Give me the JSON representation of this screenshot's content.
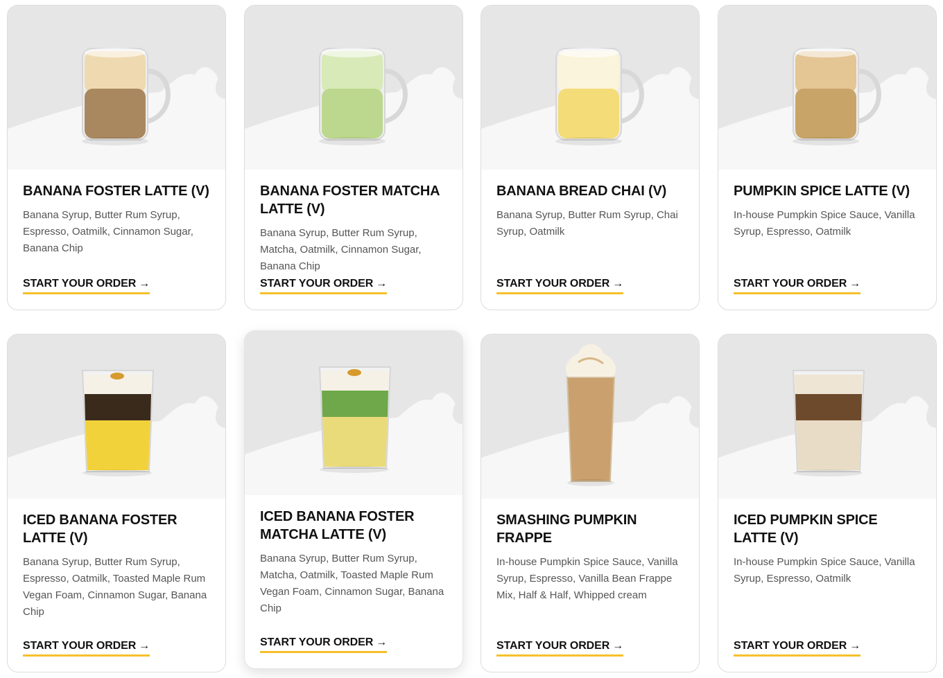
{
  "menu": {
    "cta_label": "START YOUR ORDER",
    "cta_arrow": "→",
    "accent_color": "#f6c02a",
    "items": [
      {
        "title": "BANANA FOSTER LATTE (V)",
        "description": "Banana Syrup, Butter Rum Syrup, Espresso, Oatmilk, Cinnamon Sugar, Banana Chip",
        "image": "hot-latte-mug-icon",
        "drink_color": "#a98860",
        "foam_color": "#efd9b0"
      },
      {
        "title": "BANANA FOSTER MATCHA LATTE (V)",
        "description": "Banana Syrup, Butter Rum Syrup, Matcha, Oatmilk, Cinnamon Sugar, Banana Chip",
        "image": "matcha-mug-icon",
        "drink_color": "#bcd88e",
        "foam_color": "#d8eab8"
      },
      {
        "title": "BANANA BREAD CHAI (V)",
        "description": "Banana Syrup, Butter Rum Syrup, Chai Syrup, Oatmilk",
        "image": "chai-mug-icon",
        "drink_color": "#f4dc78",
        "foam_color": "#fbf4dc"
      },
      {
        "title": "PUMPKIN SPICE LATTE (V)",
        "description": "In-house Pumpkin Spice Sauce, Vanilla Syrup, Espresso, Oatmilk",
        "image": "pumpkin-latte-mug-icon",
        "drink_color": "#c9a468",
        "foam_color": "#e4c594"
      },
      {
        "title": "ICED BANANA FOSTER LATTE (V)",
        "description": "Banana Syrup, Butter Rum Syrup, Espresso, Oatmilk, Toasted Maple Rum Vegan Foam, Cinnamon Sugar, Banana Chip",
        "image": "iced-latte-glass-icon",
        "drink_color": "#f2d23a",
        "foam_color": "#f6f1e6"
      },
      {
        "title": "ICED BANANA FOSTER MATCHA LATTE (V)",
        "description": "Banana Syrup, Butter Rum Syrup, Matcha, Oatmilk, Toasted Maple Rum Vegan Foam, Cinnamon Sugar, Banana Chip",
        "image": "iced-matcha-glass-icon",
        "drink_color": "#eadb7a",
        "foam_color": "#f6f1e6"
      },
      {
        "title": "SMASHING PUMPKIN FRAPPE",
        "description": "In-house Pumpkin Spice Sauce, Vanilla Syrup, Espresso, Vanilla Bean Frappe Mix, Half & Half, Whipped cream",
        "image": "frappe-glass-icon",
        "drink_color": "#c9a06e",
        "foam_color": "#f7f1e4"
      },
      {
        "title": "ICED PUMPKIN SPICE LATTE (V)",
        "description": "In-house Pumpkin Spice Sauce, Vanilla Syrup, Espresso, Oatmilk",
        "image": "iced-pumpkin-glass-icon",
        "drink_color": "#6e4a2c",
        "foam_color": "#efe5d4"
      }
    ]
  }
}
